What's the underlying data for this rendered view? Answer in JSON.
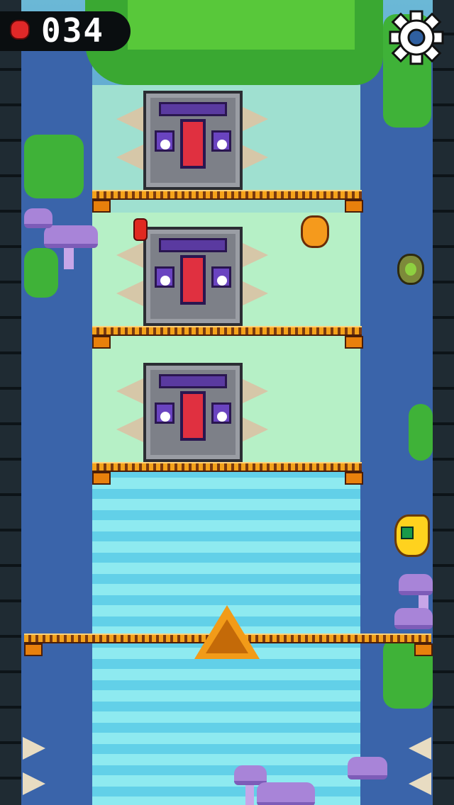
{
  "hud": {
    "score": "034",
    "collectible_icon": "strawberry-icon"
  },
  "settings_icon": "gear-icon",
  "colors": {
    "hud_background": "#0a0e10",
    "score_text": "#ffffff",
    "platform": "#f4a21a",
    "spike_block": "#7d8088",
    "waterfall": "#62d0e8",
    "hero": "#ffd21e"
  },
  "collectibles": [
    "orange",
    "kiwi",
    "red-pepper"
  ],
  "hazards": [
    "spike-block",
    "spike-block",
    "spike-block",
    "warning-sign",
    "wall-spikes"
  ]
}
